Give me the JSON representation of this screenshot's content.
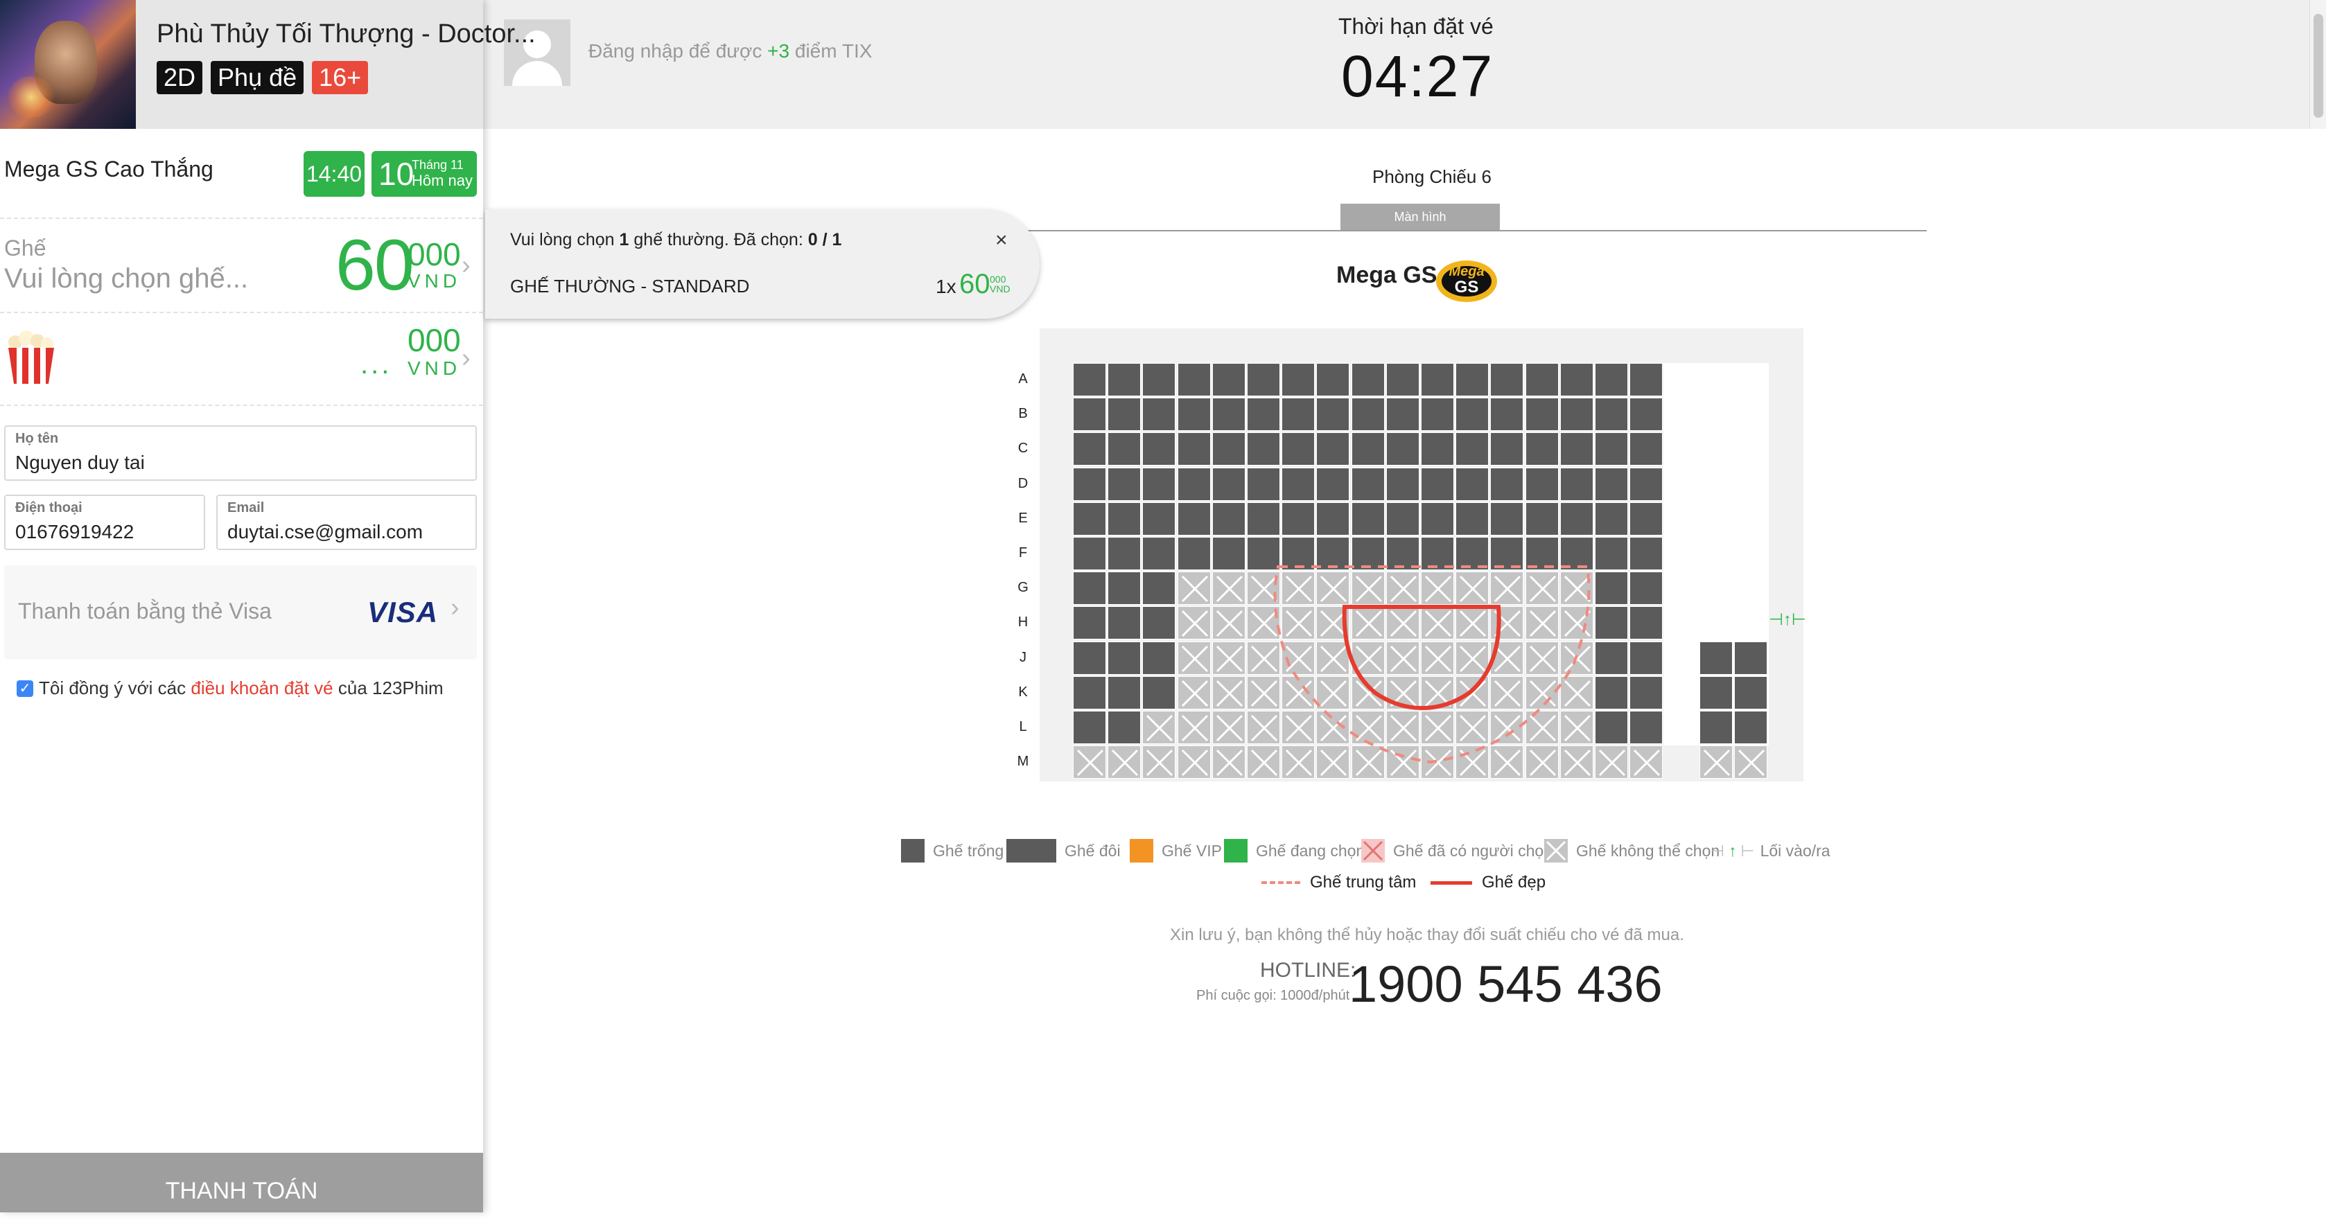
{
  "film": {
    "title": "Phù Thủy Tối Thượng - Doctor...",
    "badges": [
      "2D",
      "Phụ đề",
      "16+"
    ]
  },
  "showtime": {
    "cinema": "Mega GS Cao Thắng",
    "time": "14:40",
    "day": "10",
    "month": "Tháng 11",
    "day_label": "Hôm nay"
  },
  "seat": {
    "label": "Ghế",
    "hint": "Vui lòng chọn ghế...",
    "price_main": "60",
    "price_thousand": "000",
    "currency": "VND"
  },
  "combo": {
    "dots": "...",
    "price_thousand": "000",
    "currency": "VND"
  },
  "form": {
    "name_label": "Họ tên",
    "name_value": "Nguyen duy tai",
    "phone_label": "Điện thoại",
    "phone_value": "01676919422",
    "email_label": "Email",
    "email_value": "duytai.cse@gmail.com"
  },
  "payment": {
    "method_label": "Thanh toán bằng thẻ Visa",
    "brand": "VISA",
    "agree_prefix": "Tôi đồng ý với các ",
    "agree_link": "điều khoản đặt vé",
    "agree_suffix": " của 123Phim",
    "agreed": true,
    "submit_label": "THANH TOÁN"
  },
  "header": {
    "login_prefix": "Đăng nhập để được ",
    "login_points": "+3",
    "login_suffix": " điểm TIX",
    "timer_label": "Thời hạn đặt vé",
    "timer_value": "04:27"
  },
  "room": {
    "name": "Phòng Chiếu 6",
    "screen_label": "Màn hình",
    "brand_name": "Mega GS",
    "logo_text": "Mega GS"
  },
  "popup": {
    "msg_prefix": "Vui lòng chọn ",
    "msg_count": "1",
    "msg_mid": " ghế thường. Đã chọn: ",
    "msg_selected": "0 / 1",
    "close": "×",
    "seat_type": "GHẾ THƯỜNG - STANDARD",
    "qty": "1x",
    "price": "60",
    "price_thousand": "000",
    "currency": "VND"
  },
  "seatmap": {
    "rows": [
      "A",
      "B",
      "C",
      "D",
      "E",
      "F",
      "G",
      "H",
      "J",
      "K",
      "L",
      "M"
    ],
    "legend": [
      {
        "label": "Ghế trống",
        "color": "#5b5b5b"
      },
      {
        "label": "Ghế đôi",
        "color": "#5b5b5b"
      },
      {
        "label": "Ghế VIP",
        "color": "#f39324"
      },
      {
        "label": "Ghế đang chọn",
        "color": "#2fb34a"
      },
      {
        "label": "Ghế đã có người chọn",
        "color": "#f2b9b9"
      },
      {
        "label": "Ghế không thể chọn",
        "color": "#c4c4c4"
      },
      {
        "label": "Lối vào/ra",
        "color": "#2fb34a"
      }
    ],
    "legend2": [
      {
        "label": "Ghế trung tâm",
        "color": "#f08a7e"
      },
      {
        "label": "Ghế đẹp",
        "color": "#e63b2e"
      }
    ]
  },
  "footer": {
    "notice": "Xin lưu ý, bạn không thể hủy hoặc thay đổi suất chiếu cho vé đã mua.",
    "hotline_label": "HOTLINE:",
    "hotline_fee": "Phí cuộc gọi: 1000đ/phút",
    "hotline_number": "1900 545 436"
  }
}
